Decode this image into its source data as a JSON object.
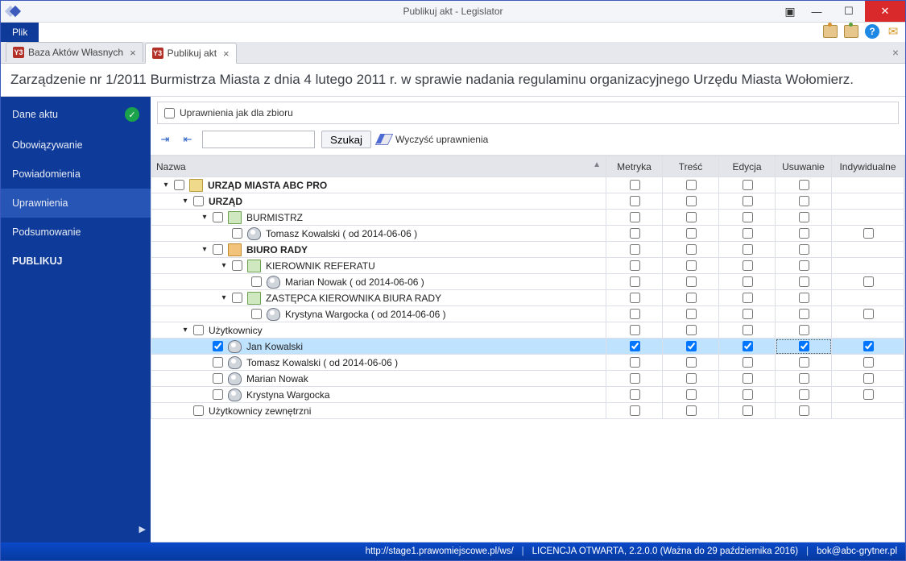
{
  "window": {
    "title": "Publikuj akt - Legislator"
  },
  "menu": {
    "file": "Plik"
  },
  "tabs": [
    {
      "label": "Baza Aktów Własnych",
      "active": false
    },
    {
      "label": "Publikuj akt",
      "active": true
    }
  ],
  "heading": "Zarządzenie nr 1/2011 Burmistrza Miasta z dnia 4 lutego 2011 r. w sprawie nadania regulaminu organizacyjnego Urzędu Miasta Wołomierz.",
  "sidebar": {
    "items": [
      {
        "label": "Dane aktu",
        "check": true
      },
      {
        "label": "Obowiązywanie"
      },
      {
        "label": "Powiadomienia"
      },
      {
        "label": "Uprawnienia",
        "active": true
      },
      {
        "label": "Podsumowanie"
      },
      {
        "label": "PUBLIKUJ",
        "publish": true
      }
    ]
  },
  "options": {
    "inherit_label": "Uprawnienia jak dla zbioru"
  },
  "toolbar": {
    "search_button": "Szukaj",
    "clear_label": "Wyczyść uprawnienia",
    "search_value": ""
  },
  "columns": {
    "name": "Nazwa",
    "metryka": "Metryka",
    "tresc": "Treść",
    "edycja": "Edycja",
    "usuwanie": "Usuwanie",
    "indyw": "Indywidualne"
  },
  "rows": [
    {
      "indent": 0,
      "arrow": "▾",
      "cb": true,
      "icon": "building",
      "text": "URZĄD MIASTA ABC PRO",
      "bold": true,
      "cells": [
        "m",
        "t",
        "e",
        "u"
      ]
    },
    {
      "indent": 1,
      "arrow": "▾",
      "cb": true,
      "icon": "",
      "text": "URZĄD",
      "bold": true,
      "cells": [
        "m",
        "t",
        "e",
        "u"
      ]
    },
    {
      "indent": 2,
      "arrow": "▾",
      "cb": true,
      "icon": "monitor",
      "text": "BURMISTRZ",
      "cells": [
        "m",
        "t",
        "e",
        "u"
      ]
    },
    {
      "indent": 3,
      "arrow": "",
      "cb": true,
      "icon": "person",
      "text": "Tomasz Kowalski ( od 2014-06-06 )",
      "cells": [
        "m",
        "t",
        "e",
        "u",
        "i"
      ]
    },
    {
      "indent": 2,
      "arrow": "▾",
      "cb": true,
      "icon": "board",
      "text": "BIURO RADY",
      "bold": true,
      "cells": [
        "m",
        "t",
        "e",
        "u"
      ]
    },
    {
      "indent": 3,
      "arrow": "▾",
      "cb": true,
      "icon": "monitor",
      "text": "KIEROWNIK REFERATU",
      "cells": [
        "m",
        "t",
        "e",
        "u"
      ]
    },
    {
      "indent": 4,
      "arrow": "",
      "cb": true,
      "icon": "person",
      "text": "Marian Nowak ( od 2014-06-06 )",
      "cells": [
        "m",
        "t",
        "e",
        "u",
        "i"
      ]
    },
    {
      "indent": 3,
      "arrow": "▾",
      "cb": true,
      "icon": "monitor",
      "text": "ZASTĘPCA KIEROWNIKA BIURA RADY",
      "cells": [
        "m",
        "t",
        "e",
        "u"
      ]
    },
    {
      "indent": 4,
      "arrow": "",
      "cb": true,
      "icon": "person",
      "text": "Krystyna Wargocka ( od 2014-06-06 )",
      "cells": [
        "m",
        "t",
        "e",
        "u",
        "i"
      ]
    },
    {
      "indent": 1,
      "arrow": "▾",
      "cb": true,
      "icon": "",
      "text": "Użytkownicy",
      "cells": [
        "m",
        "t",
        "e",
        "u"
      ]
    },
    {
      "indent": 2,
      "arrow": "",
      "cb": true,
      "cbChecked": true,
      "icon": "person",
      "text": "Jan Kowalski",
      "cells": [
        "m",
        "t",
        "e",
        "u",
        "i"
      ],
      "checked": [
        "m",
        "t",
        "e",
        "u",
        "i"
      ],
      "selected": true,
      "focus": "u"
    },
    {
      "indent": 2,
      "arrow": "",
      "cb": true,
      "icon": "person",
      "text": "Tomasz Kowalski ( od 2014-06-06 )",
      "cells": [
        "m",
        "t",
        "e",
        "u",
        "i"
      ]
    },
    {
      "indent": 2,
      "arrow": "",
      "cb": true,
      "icon": "person",
      "text": "Marian Nowak",
      "cells": [
        "m",
        "t",
        "e",
        "u",
        "i"
      ]
    },
    {
      "indent": 2,
      "arrow": "",
      "cb": true,
      "icon": "person",
      "text": "Krystyna Wargocka",
      "cells": [
        "m",
        "t",
        "e",
        "u",
        "i"
      ]
    },
    {
      "indent": 1,
      "arrow": "",
      "cb": true,
      "icon": "",
      "text": "Użytkownicy zewnętrzni",
      "cells": [
        "m",
        "t",
        "e",
        "u"
      ]
    }
  ],
  "footer": {
    "url": "http://stage1.prawomiejscowe.pl/ws/",
    "license": "LICENCJA OTWARTA, 2.2.0.0 (Ważna do 29 października 2016)",
    "email": "bok@abc-grytner.pl"
  }
}
